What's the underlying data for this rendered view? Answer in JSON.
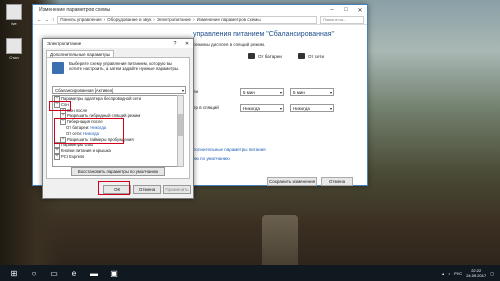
{
  "desktop": {
    "icons": [
      {
        "label": "ive"
      },
      {
        "label": "Стол"
      }
    ]
  },
  "main_window": {
    "title": "Изменение параметров схемы",
    "breadcrumb": [
      "Панель управления",
      "Оборудование и звук",
      "Электропитание",
      "Изменение параметров схемы"
    ],
    "search_placeholder": "Поиск в па...",
    "plan_title": "управления питанием \"Сбалансированная\"",
    "plan_subtitle": "режимы дисплея в спящий режим.",
    "col_battery": "От батареи",
    "col_ac": "От сети",
    "row_display": "еи",
    "row_sleep": "ер в спящий",
    "display_battery": "5 мин",
    "display_ac": "5 мин",
    "sleep_battery": "Никогда",
    "sleep_ac": "Никогда",
    "link_advanced": "полнительные параметры питания",
    "link_restore": "ию по умолчанию",
    "save_button": "Сохранить изменения",
    "cancel_button": "Отмена"
  },
  "dialog": {
    "title": "Электропитание",
    "help": "?",
    "tab": "Дополнительные параметры",
    "description": "Выберите схему управления питанием, которую вы хотите настроить, а затем задайте нужные параметры.",
    "plan_selected": "Сбалансированная [Активен]",
    "tree": [
      {
        "exp": "+",
        "label": "Параметры адаптера беспроводной сети",
        "indent": 0
      },
      {
        "exp": "−",
        "label": "Сон",
        "indent": 0
      },
      {
        "exp": "+",
        "label": "Сон после",
        "indent": 1
      },
      {
        "exp": "+",
        "label": "Разрешить гибридный спящий режим",
        "indent": 1
      },
      {
        "exp": "−",
        "label": "Гибернация после",
        "indent": 1
      },
      {
        "exp": "",
        "label": "От батареи: ",
        "value": "Никогда",
        "indent": 2
      },
      {
        "exp": "",
        "label": "От сети: ",
        "value": "Никогда",
        "indent": 2
      },
      {
        "exp": "+",
        "label": "Разрешить таймеры пробуждения",
        "indent": 1
      },
      {
        "exp": "+",
        "label": "Параметры USB",
        "indent": 0
      },
      {
        "exp": "+",
        "label": "Кнопки питания и крышка",
        "indent": 0
      },
      {
        "exp": "+",
        "label": "PCI Express",
        "indent": 0
      }
    ],
    "restore_button": "Восстановить параметры по умолчанию",
    "ok_button": "ОК",
    "cancel_button": "Отмена",
    "apply_button": "Применить"
  },
  "taskbar": {
    "time": "22:22",
    "date": "24.09.2017",
    "lang": "РУС"
  },
  "colors": {
    "highlight": "#d0021b",
    "link": "#1a5bb5"
  }
}
